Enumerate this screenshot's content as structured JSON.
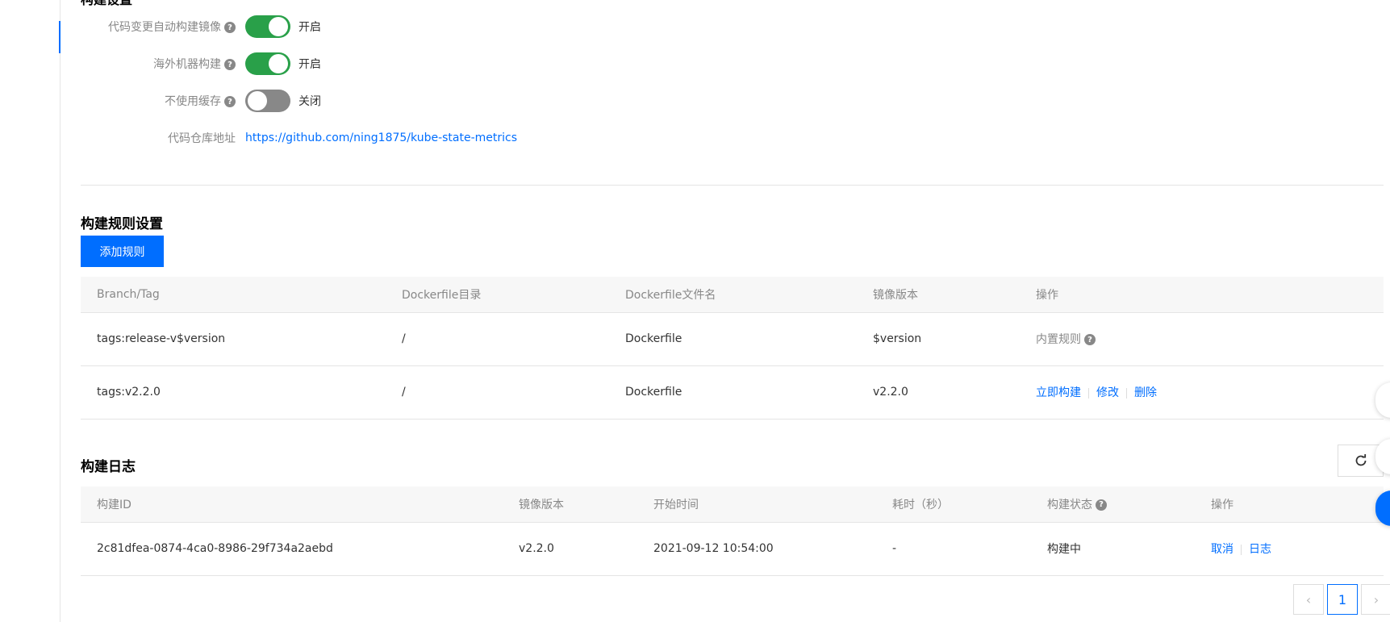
{
  "build_settings": {
    "title": "构建设置",
    "rows": [
      {
        "label": "代码变更自动构建镜像",
        "state": "开启",
        "on": true
      },
      {
        "label": "海外机器构建",
        "state": "开启",
        "on": true
      },
      {
        "label": "不使用缓存",
        "state": "关闭",
        "on": false
      }
    ],
    "repo_label": "代码仓库地址",
    "repo_url": "https://github.com/ning1875/kube-state-metrics",
    "help_glyph": "?"
  },
  "rules": {
    "title": "构建规则设置",
    "add_button": "添加规则",
    "columns": [
      "Branch/Tag",
      "Dockerfile目录",
      "Dockerfile文件名",
      "镜像版本",
      "操作"
    ],
    "rows": [
      {
        "tag": "tags:release-v$version",
        "dir": "/",
        "file": "Dockerfile",
        "version": "$version",
        "builtin": "内置规则"
      },
      {
        "tag": "tags:v2.2.0",
        "dir": "/",
        "file": "Dockerfile",
        "version": "v2.2.0",
        "actions": [
          "立即构建",
          "修改",
          "删除"
        ]
      }
    ]
  },
  "logs": {
    "title": "构建日志",
    "columns": [
      "构建ID",
      "镜像版本",
      "开始时间",
      "耗时（秒）",
      "构建状态",
      "操作"
    ],
    "rows": [
      {
        "id": "2c81dfea-0874-4ca0-8986-29f734a2aebd",
        "version": "v2.2.0",
        "start": "2021-09-12 10:54:00",
        "duration": "-",
        "status": "构建中",
        "actions": [
          "取消",
          "日志"
        ]
      }
    ],
    "refresh_icon": "refresh-icon"
  },
  "pagination": {
    "prev": "‹",
    "current": "1",
    "next": "›"
  },
  "colors": {
    "accent": "#006eff",
    "toggle_on": "#29a049",
    "toggle_off": "#888888"
  }
}
